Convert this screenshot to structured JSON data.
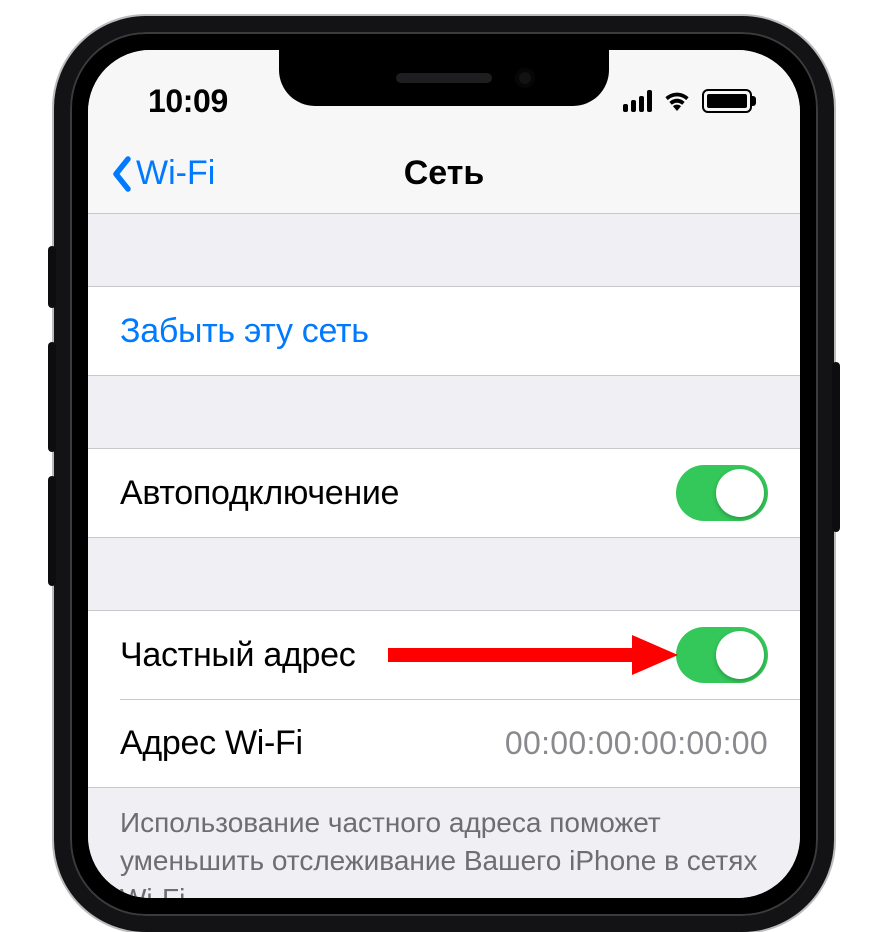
{
  "status": {
    "time": "10:09"
  },
  "nav": {
    "back_label": "Wi-Fi",
    "title": "Сеть"
  },
  "forget": {
    "label": "Забыть эту сеть"
  },
  "auto_join": {
    "label": "Автоподключение",
    "on": true
  },
  "private_address": {
    "label": "Частный адрес",
    "on": true
  },
  "wifi_address": {
    "label": "Адрес Wi-Fi",
    "value": "00:00:00:00:00:00"
  },
  "footer": {
    "text": "Использование частного адреса поможет уменьшить отслеживание Вашего iPhone в сетях Wi-Fi."
  }
}
